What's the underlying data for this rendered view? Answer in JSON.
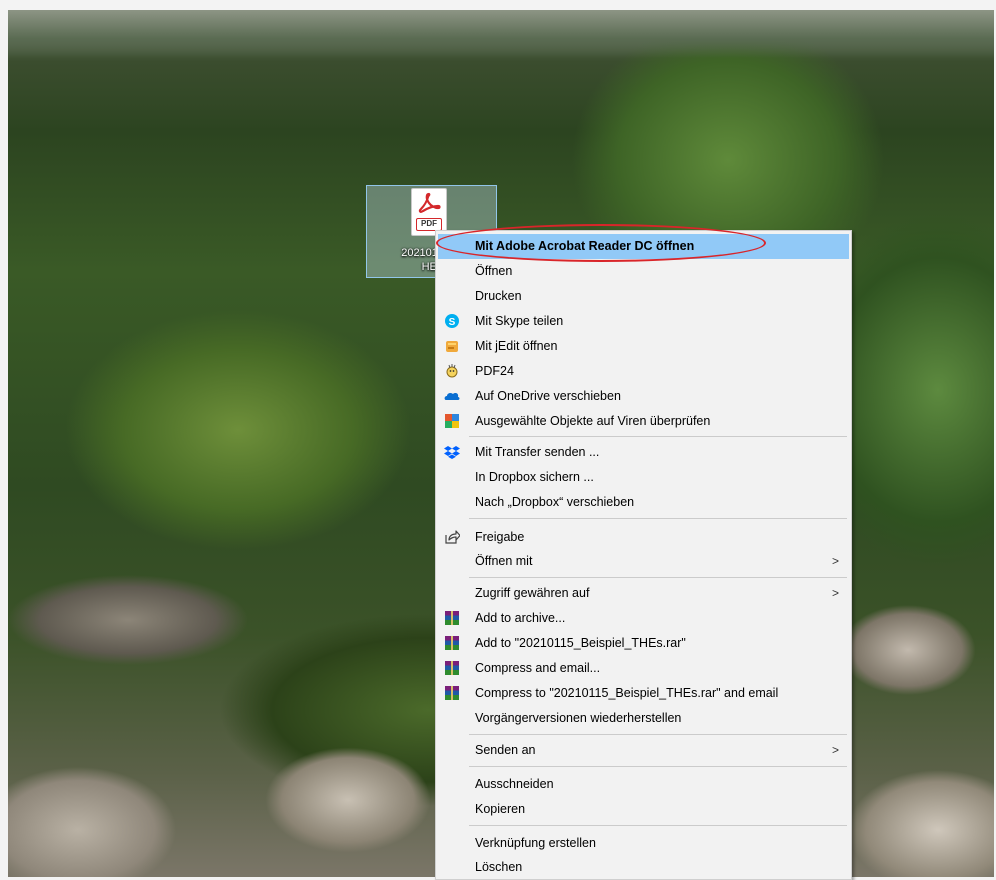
{
  "desktop": {
    "file_icon": {
      "badge": "PDF",
      "label": "20210115_Beispiel_THEs.pdf",
      "label_visible_line1": "20210115_B",
      "label_visible_line2": "HEs"
    }
  },
  "context_menu": {
    "items": [
      {
        "label": "Mit Adobe Acrobat Reader DC öffnen",
        "icon": "none",
        "highlighted": true
      },
      {
        "label": "Öffnen",
        "icon": "none"
      },
      {
        "label": "Drucken",
        "icon": "none"
      },
      {
        "label": "Mit Skype teilen",
        "icon": "skype-icon"
      },
      {
        "label": "Mit jEdit öffnen",
        "icon": "jedit-icon"
      },
      {
        "label": "PDF24",
        "icon": "pdf24-icon"
      },
      {
        "label": "Auf OneDrive verschieben",
        "icon": "onedrive-icon"
      },
      {
        "label": "Ausgewählte Objekte auf Viren überprüfen",
        "icon": "defender-icon"
      },
      {
        "label": "Mit Transfer senden ...",
        "icon": "dropbox-icon"
      },
      {
        "label": "In Dropbox sichern ...",
        "icon": "none"
      },
      {
        "label": "Nach „Dropbox“ verschieben",
        "icon": "none"
      },
      {
        "label": "Freigabe",
        "icon": "share-icon"
      },
      {
        "label": "Öffnen mit",
        "icon": "none",
        "submenu": true
      },
      {
        "label": "Zugriff gewähren auf",
        "icon": "none",
        "submenu": true
      },
      {
        "label": "Add to archive...",
        "icon": "winrar-icon"
      },
      {
        "label": "Add to \"20210115_Beispiel_THEs.rar\"",
        "icon": "winrar-icon"
      },
      {
        "label": "Compress and email...",
        "icon": "winrar-icon"
      },
      {
        "label": "Compress to \"20210115_Beispiel_THEs.rar\" and email",
        "icon": "winrar-icon"
      },
      {
        "label": "Vorgängerversionen wiederherstellen",
        "icon": "none"
      },
      {
        "label": "Senden an",
        "icon": "none",
        "submenu": true
      },
      {
        "label": "Ausschneiden",
        "icon": "none"
      },
      {
        "label": "Kopieren",
        "icon": "none"
      },
      {
        "label": "Verknüpfung erstellen",
        "icon": "none"
      },
      {
        "label": "Löschen",
        "icon": "none"
      }
    ],
    "submenu_arrow": ">"
  },
  "colors": {
    "menu_bg": "#f2f2f2",
    "highlight": "#91c9f7",
    "annotation": "#d9252a",
    "acrobat_red": "#d3282b"
  }
}
